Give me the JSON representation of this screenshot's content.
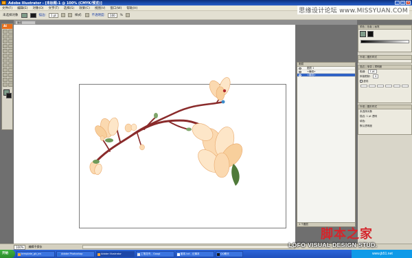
{
  "window": {
    "title": "Adobe Illustrator - [未标题-1 @ 100% (CMYK/预览)]",
    "controls": [
      "_",
      "□",
      "×"
    ]
  },
  "watermark_top": "思缘设计论坛 www.MISSYUAN.COM",
  "menu": [
    "文件(F)",
    "编辑(E)",
    "对象(O)",
    "文字(T)",
    "选择(S)",
    "效果(C)",
    "视图(V)",
    "窗口(W)",
    "帮助(H)"
  ],
  "control_bar": {
    "selection_label": "未选择对象",
    "stroke_label": "描边:",
    "stroke_value": "1 pt",
    "style_label": "样式:",
    "opacity_label": "不透明度:",
    "opacity_value": "100",
    "opacity_unit": "%",
    "fill_color": "#7f9c8a"
  },
  "doc_tab": "编组",
  "toolbox": {
    "header": "Ai"
  },
  "panels": {
    "color": {
      "title": "颜色 | 色板 | 画笔"
    },
    "appearance": {
      "title": "外观 | 图形样式"
    },
    "stroke": {
      "title": "描边 | 渐变 | 透明度",
      "weight_label": "粗细:",
      "weight_value": "1 pt",
      "miter_label": "斜接限制:",
      "miter_value": "4",
      "dashed_label": "虚线"
    },
    "info": {
      "title": "外观 | 图形样式",
      "row1": "未选择对象",
      "row2_label": "描边:",
      "row2_value": "1 pt 透明",
      "row3": "填色:",
      "row4": "默认透明度"
    }
  },
  "layers": {
    "title": "图层",
    "rows": [
      "图层 1",
      "<编组>",
      "<编组>"
    ],
    "footer": "1 个图层"
  },
  "status": {
    "zoom": "100%",
    "status_text": "编辑不保存",
    "page": "1"
  },
  "taskbar": {
    "start": "开始",
    "tasks": [
      "template_gb_en",
      "Adobe Photoshop",
      "Adobe Illustrator",
      "工笔花鸟 - Googl",
      "副本.txt - 记事本",
      "QQ聊天"
    ]
  },
  "watermarks": {
    "cn": "脚本之家",
    "en": "LOFO VISUAL DESIGN STUD.",
    "url": "www.jb51.net"
  },
  "colors": {
    "petal": "#fbd9b0",
    "petal_edge": "#e9a86a",
    "branch": "#8a2b2b",
    "leaf": "#4f7a3a",
    "bud_blue": "#3c8bc9"
  }
}
